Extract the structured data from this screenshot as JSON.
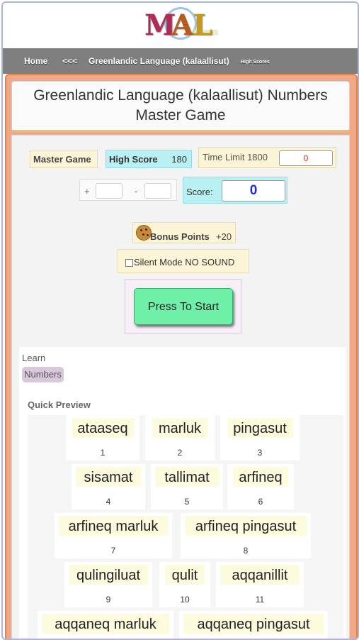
{
  "logo": {
    "letters": [
      "M",
      "A",
      "L"
    ]
  },
  "nav": {
    "home": "Home",
    "back": "<<<",
    "language": "Greenlandic Language (kalaallisut)",
    "high_scores": "High Scores"
  },
  "title": {
    "line1": "Greenlandic Language (kalaallisut) Numbers",
    "line2": "Master Game"
  },
  "game": {
    "master_game": "Master Game",
    "high_score_label": "High Score",
    "high_score_value": "180",
    "time_limit_label": "Time Limit 1800",
    "time_value": "0",
    "plus_label": "+",
    "minus_label": "-",
    "score_label": "Score:",
    "score_value": "0",
    "bonus_label": "Bonus Points",
    "bonus_value": "+20",
    "silent_label": "Silent Mode NO SOUND",
    "start_label": "Press To Start"
  },
  "learn": {
    "label": "Learn",
    "tag": "Numbers",
    "preview_label": "Quick Preview"
  },
  "cards": [
    {
      "word": "ataaseq",
      "num": "1"
    },
    {
      "word": "marluk",
      "num": "2"
    },
    {
      "word": "pingasut",
      "num": "3"
    },
    {
      "word": "sisamat",
      "num": "4"
    },
    {
      "word": "tallimat",
      "num": "5"
    },
    {
      "word": "arfineq",
      "num": "6"
    },
    {
      "word": "arfineq marluk",
      "num": "7"
    },
    {
      "word": "arfineq pingasut",
      "num": "8"
    },
    {
      "word": "qulingiluat",
      "num": "9"
    },
    {
      "word": "qulit",
      "num": "10"
    },
    {
      "word": "aqqanillit",
      "num": "11"
    },
    {
      "word": "aqqaneq marluk",
      "num": ""
    },
    {
      "word": "aqqaneq pingasut",
      "num": ""
    }
  ]
}
